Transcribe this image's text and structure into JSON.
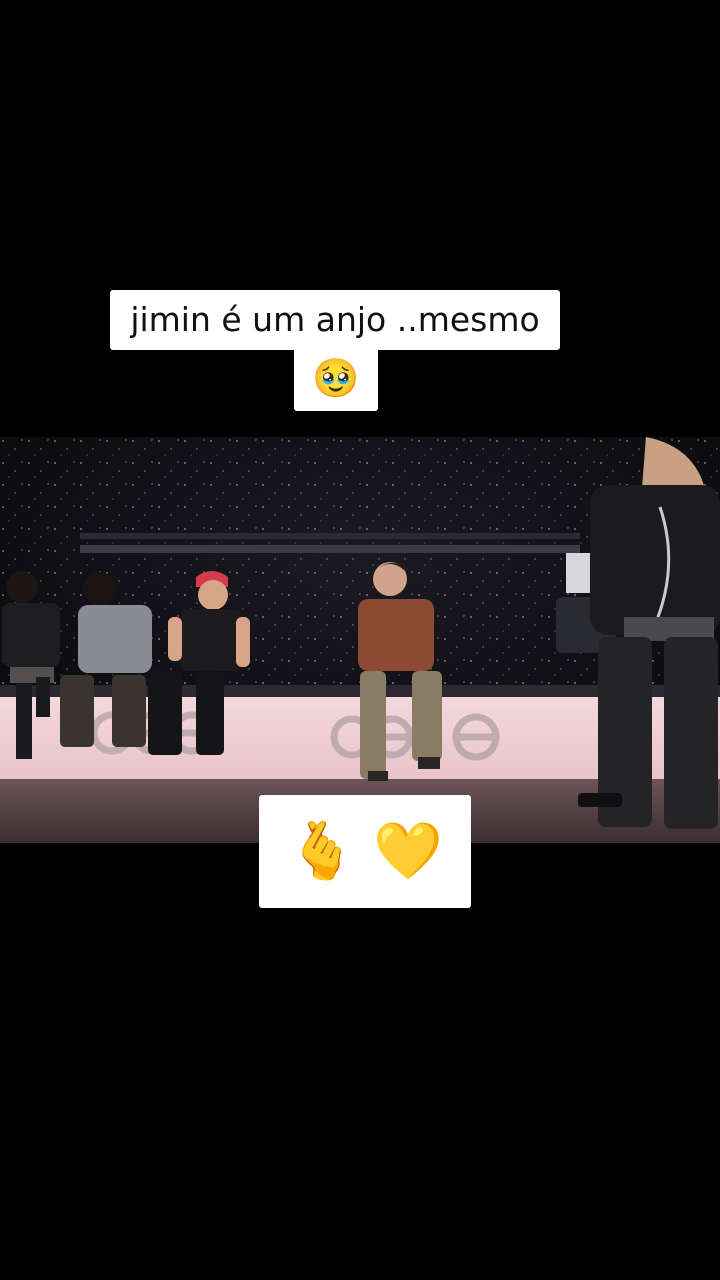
{
  "caption": {
    "text": "jimin é um anjo ..mesmo",
    "emoji": "🥹"
  },
  "sticker": {
    "hand_emoji": "🫰",
    "heart_emoji": "💛"
  },
  "video": {
    "stage_logo_left": "⊙⊖⊖",
    "stage_logo_right": "⊙⊖⊖"
  }
}
